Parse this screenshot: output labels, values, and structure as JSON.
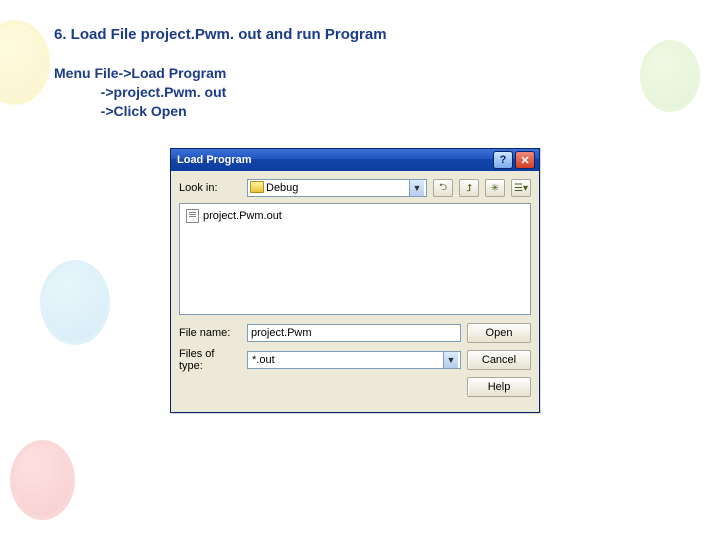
{
  "heading": "6. Load File project.Pwm. out and run Program",
  "instructions": {
    "l1": "Menu File->Load Program",
    "l2": "            ->project.Pwm. out",
    "l3": "            ->Click Open"
  },
  "dialog": {
    "title": "Load Program",
    "lookin_label": "Look in:",
    "lookin_value": "Debug",
    "file_item": "project.Pwm.out",
    "filename_label": "File name:",
    "filename_value": "project.Pwm",
    "filetype_label": "Files of type:",
    "filetype_value": "*.out",
    "open_btn": "Open",
    "cancel_btn": "Cancel",
    "help_btn": "Help"
  }
}
